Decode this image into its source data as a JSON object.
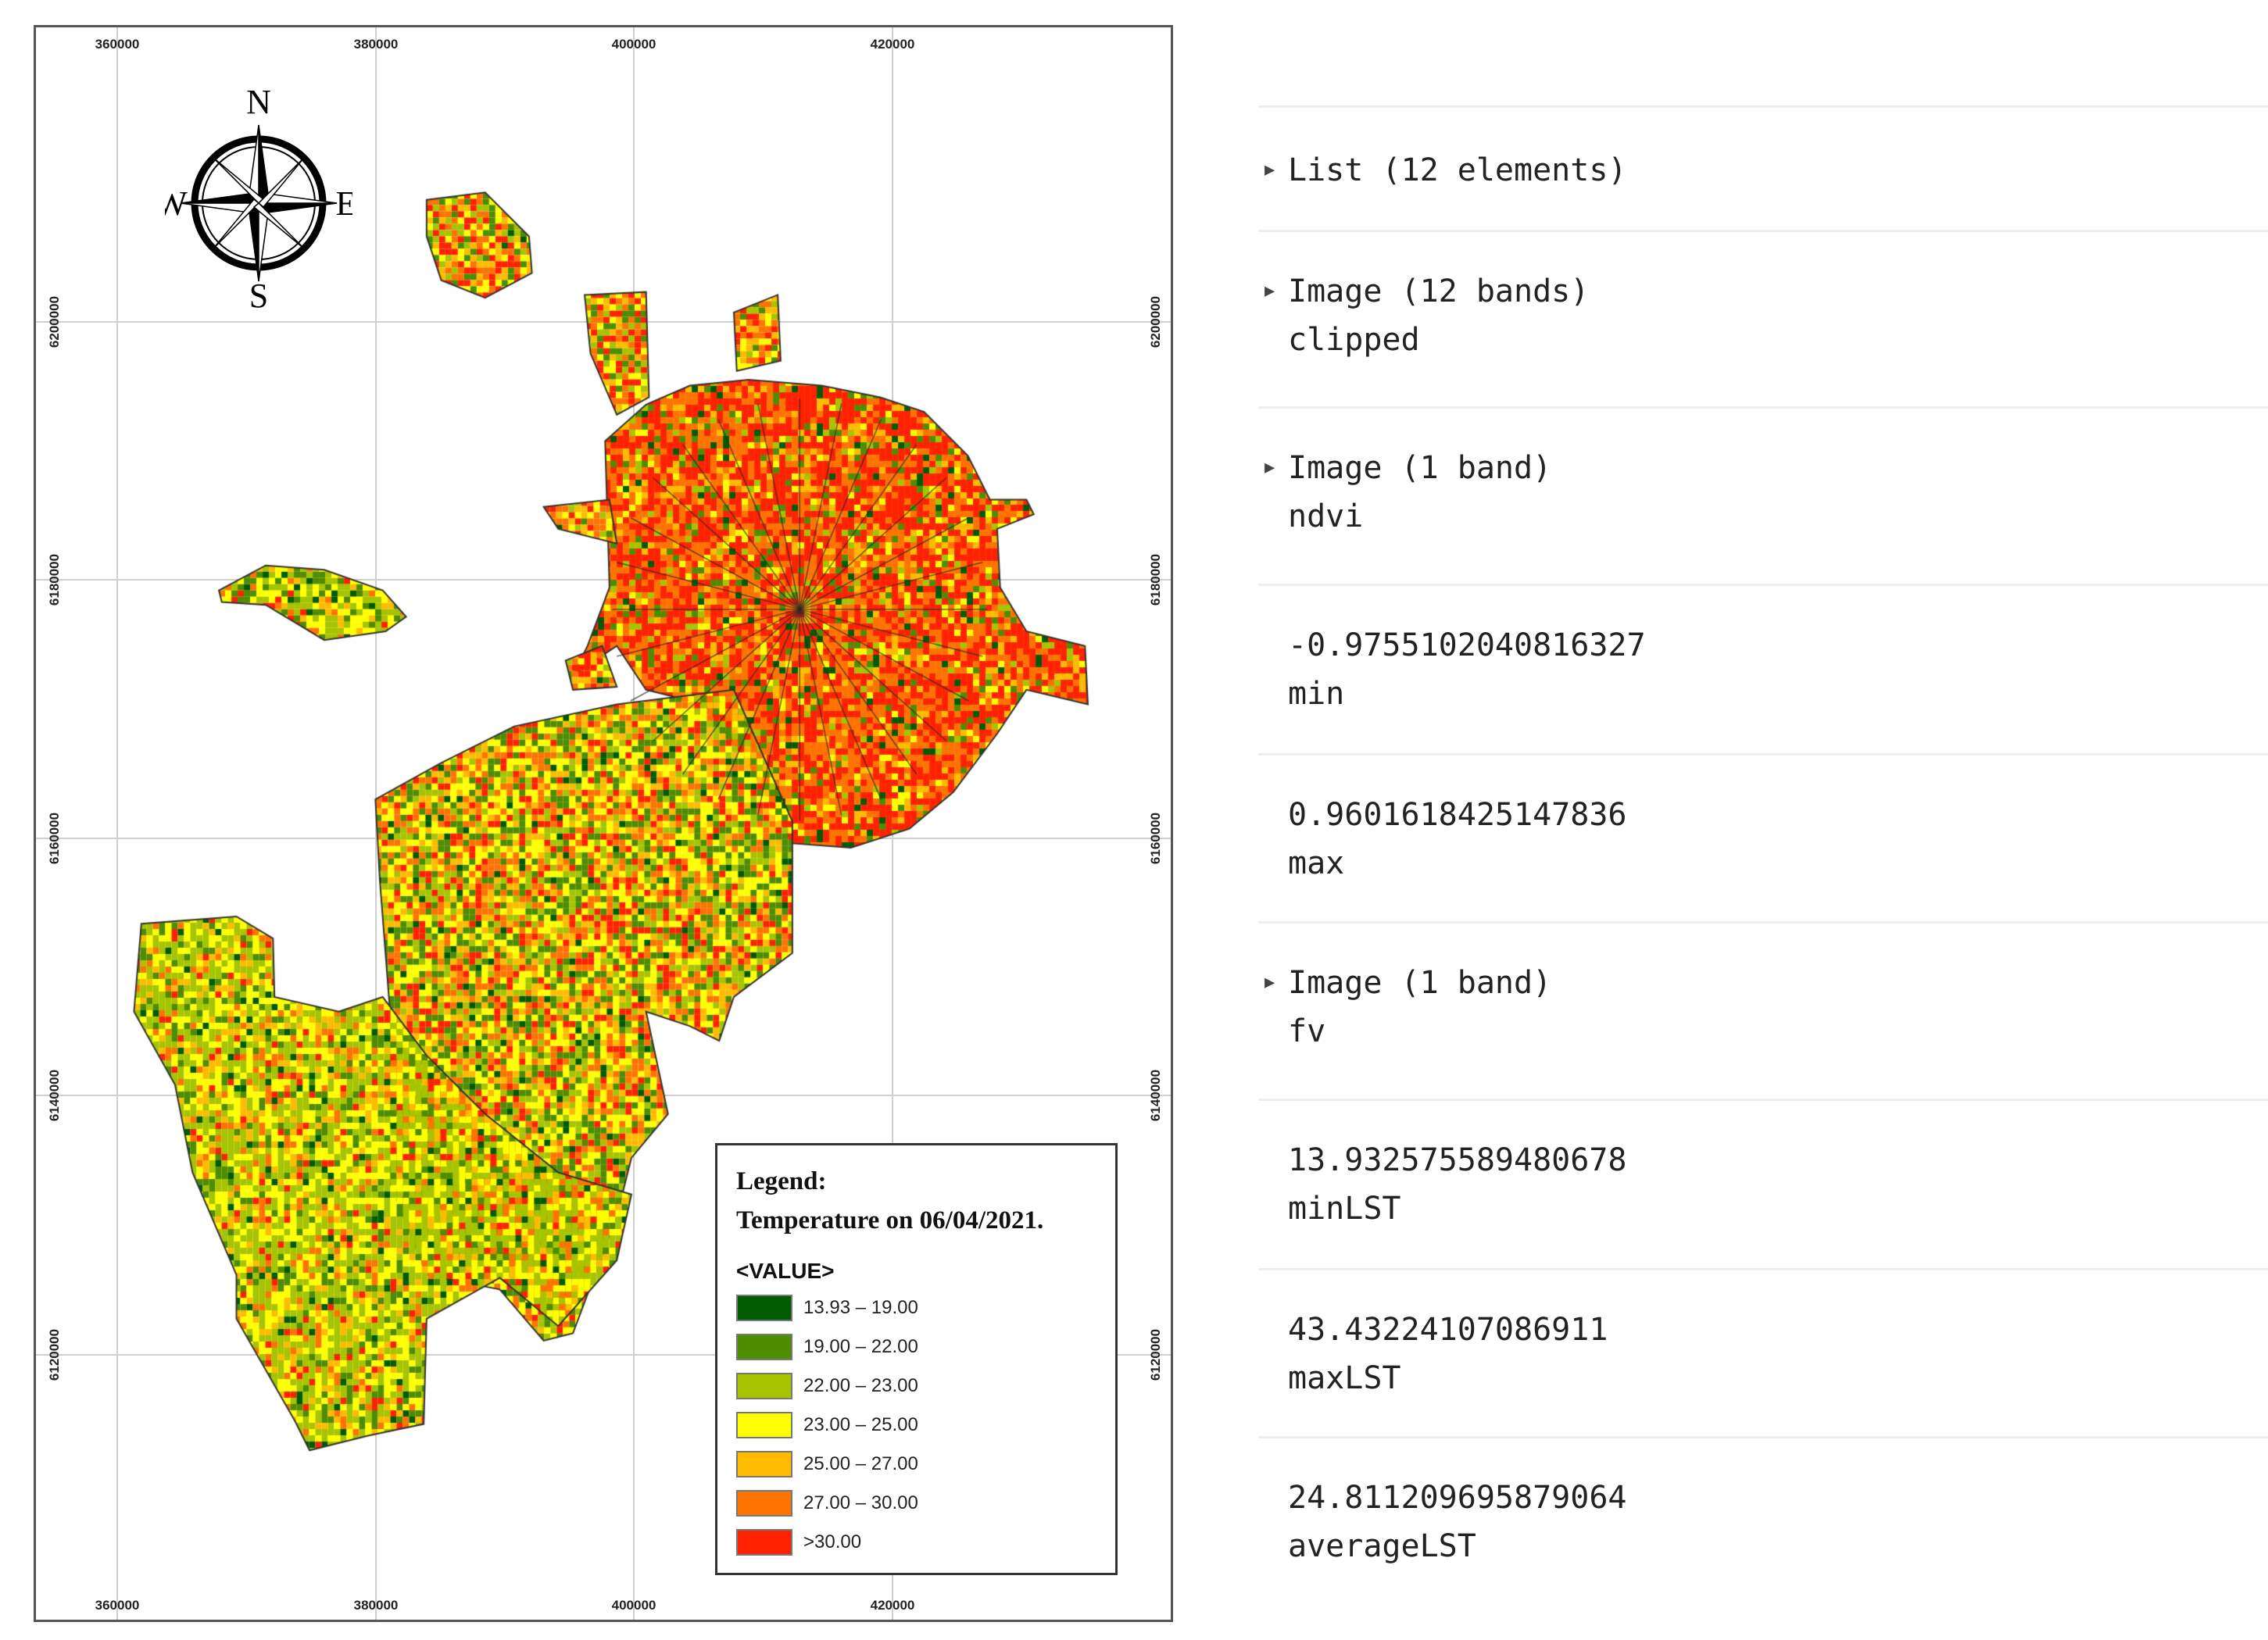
{
  "map": {
    "x_ticks": [
      "360000",
      "380000",
      "400000",
      "420000"
    ],
    "y_ticks": [
      "6200000",
      "6180000",
      "6160000",
      "6140000",
      "6120000"
    ],
    "compass": {
      "n": "N",
      "s": "S",
      "e": "E",
      "w": "W"
    },
    "legend": {
      "title": "Legend:",
      "subtitle": "Temperature on 06/04/2021.",
      "field": "<VALUE>",
      "classes": [
        {
          "label": "13.93 – 19.00",
          "color": "#005c00"
        },
        {
          "label": "19.00 – 22.00",
          "color": "#4e8c00"
        },
        {
          "label": "22.00 – 23.00",
          "color": "#a6c400"
        },
        {
          "label": "23.00 – 25.00",
          "color": "#ffff00"
        },
        {
          "label": "25.00 – 27.00",
          "color": "#ffbb00"
        },
        {
          "label": "27.00 – 30.00",
          "color": "#ff7300"
        },
        {
          "label": ">30.00",
          "color": "#ff2200"
        }
      ]
    }
  },
  "console": {
    "entries": [
      {
        "title": "List (12 elements)",
        "expandable": true
      },
      {
        "title": "Image (12 bands)",
        "sub": "clipped",
        "expandable": true
      },
      {
        "title": "Image (1 band)",
        "sub": "ndvi",
        "expandable": true
      },
      {
        "title": "-0.9755102040816327",
        "sub": "min",
        "expandable": false
      },
      {
        "title": "0.9601618425147836",
        "sub": "max",
        "expandable": false
      },
      {
        "title": "Image (1 band)",
        "sub": "fv",
        "expandable": true
      },
      {
        "title": "13.932575589480678",
        "sub": "minLST",
        "expandable": false
      },
      {
        "title": "43.43224107086911",
        "sub": "maxLST",
        "expandable": false
      },
      {
        "title": "24.811209695879064",
        "sub": "averageLST",
        "expandable": false
      }
    ]
  }
}
